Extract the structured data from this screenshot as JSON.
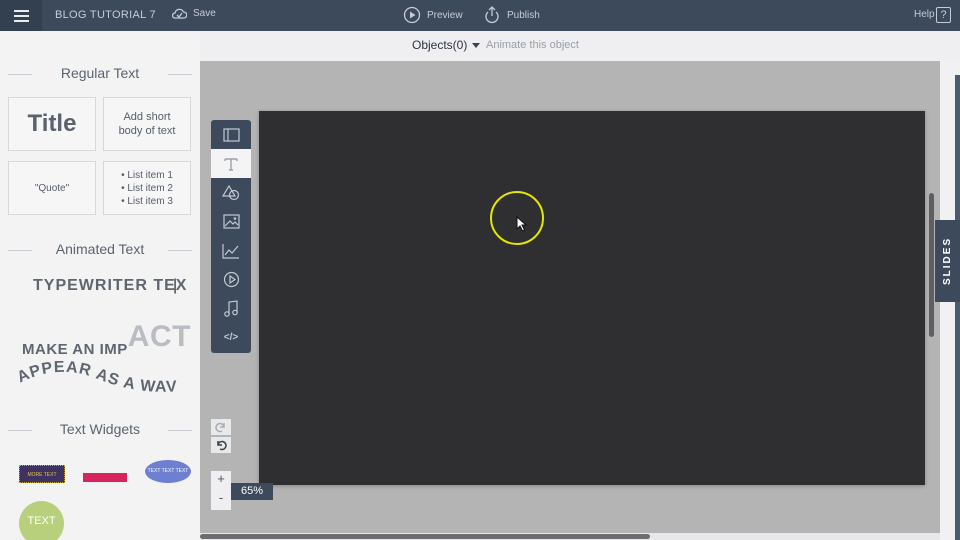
{
  "header": {
    "document_title": "BLOG TUTORIAL 7",
    "save_label": "Save",
    "preview_label": "Preview",
    "publish_label": "Publish",
    "help_label": "Help",
    "help_toggle": "?"
  },
  "subbar": {
    "objects_label": "Objects(0)",
    "animate_label": "Animate this object"
  },
  "left_panel": {
    "regular_text_heading": "Regular Text",
    "title_tile": "Title",
    "body_tile": "Add short body of text",
    "quote_tile": "\"Quote\"",
    "list_items": [
      "List item 1",
      "List item 2",
      "List item 3"
    ],
    "animated_text_heading": "Animated Text",
    "typewriter_label": "TYPEWRITER TEX",
    "impact_label": "MAKE AN IMP",
    "impact_tail": "ACT",
    "wave_label": "APPEAR AS A WAVE",
    "text_widgets_heading": "Text Widgets",
    "widget_more_text": "MORE TEXT",
    "widget_text_text_text": "TEXT TEXT TEXT",
    "widget_circle_text": "TEXT"
  },
  "toolbar_icons": [
    "layout-icon",
    "text-icon",
    "shapes-icon",
    "image-icon",
    "chart-icon",
    "video-icon",
    "music-icon",
    "embed-code-icon"
  ],
  "embed_icon_text": "</>",
  "zoom": {
    "plus": "+",
    "minus": "-",
    "level": "65%"
  },
  "slides_tab_label": "SLIDES",
  "colors": {
    "header_bg": "#3d4a5c",
    "slide_bg": "#2f2f31",
    "highlight": "#e6e600"
  }
}
